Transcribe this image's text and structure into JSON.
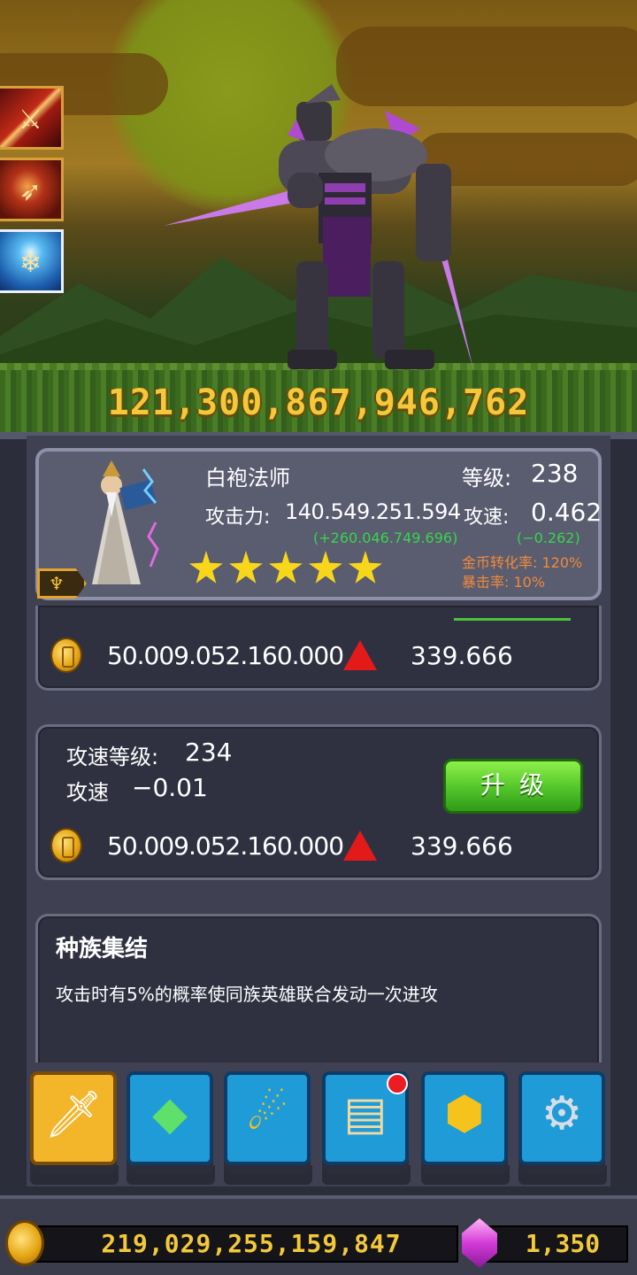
{
  "battle": {
    "damage_text": "121,300,867,946,762",
    "skill_icons": [
      "sword-slash-skill-icon",
      "bow-fire-skill-icon",
      "ice-staff-skill-icon"
    ],
    "enemy": "dark-armored-knight-enemy"
  },
  "hero": {
    "name": "白袍法师",
    "level_label": "等级:",
    "level": "238",
    "attack_label": "攻击力:",
    "attack": "140.549.251.594",
    "attack_bonus": "(+260.046.749.696)",
    "speed_label": "攻速:",
    "speed": "0.462",
    "speed_bonus": "(−0.262)",
    "gold_rate": "金币转化率: 120%",
    "crit_rate": "暴击率: 10%",
    "stars": 5
  },
  "attack_upgrade": {
    "cost": "50.009.052.160.000",
    "next": "339.666"
  },
  "speed_upgrade": {
    "level_label": "攻速等级:",
    "level": "234",
    "delta_label": "攻速",
    "delta": "−0.01",
    "button": "升级",
    "cost": "50.009.052.160.000",
    "next": "339.666"
  },
  "skill": {
    "title": "种族集结",
    "description": "攻击时有5%的概率使同族英雄联合发动一次进攻"
  },
  "nav": [
    {
      "name": "heroes-tab",
      "icon": "sword-icon",
      "active": true
    },
    {
      "name": "artifact-tab",
      "icon": "green-gem-icon",
      "active": false
    },
    {
      "name": "skills-tab",
      "icon": "golden-swirl-icon",
      "active": false
    },
    {
      "name": "codex-tab",
      "icon": "book-icon",
      "active": false,
      "notification": true
    },
    {
      "name": "shop-tab",
      "icon": "treasure-chest-icon",
      "active": false
    },
    {
      "name": "settings-tab",
      "icon": "gear-icon",
      "active": false
    }
  ],
  "currency": {
    "gold": "219,029,255,159,847",
    "gems": "1,350"
  },
  "colors": {
    "gold_text": "#f3c83a",
    "bonus_green": "#36d64a",
    "rate_orange": "#f08a3a",
    "button_green": "#52c42a",
    "nav_blue": "#1f9bd8",
    "nav_active": "#f3b52a"
  }
}
